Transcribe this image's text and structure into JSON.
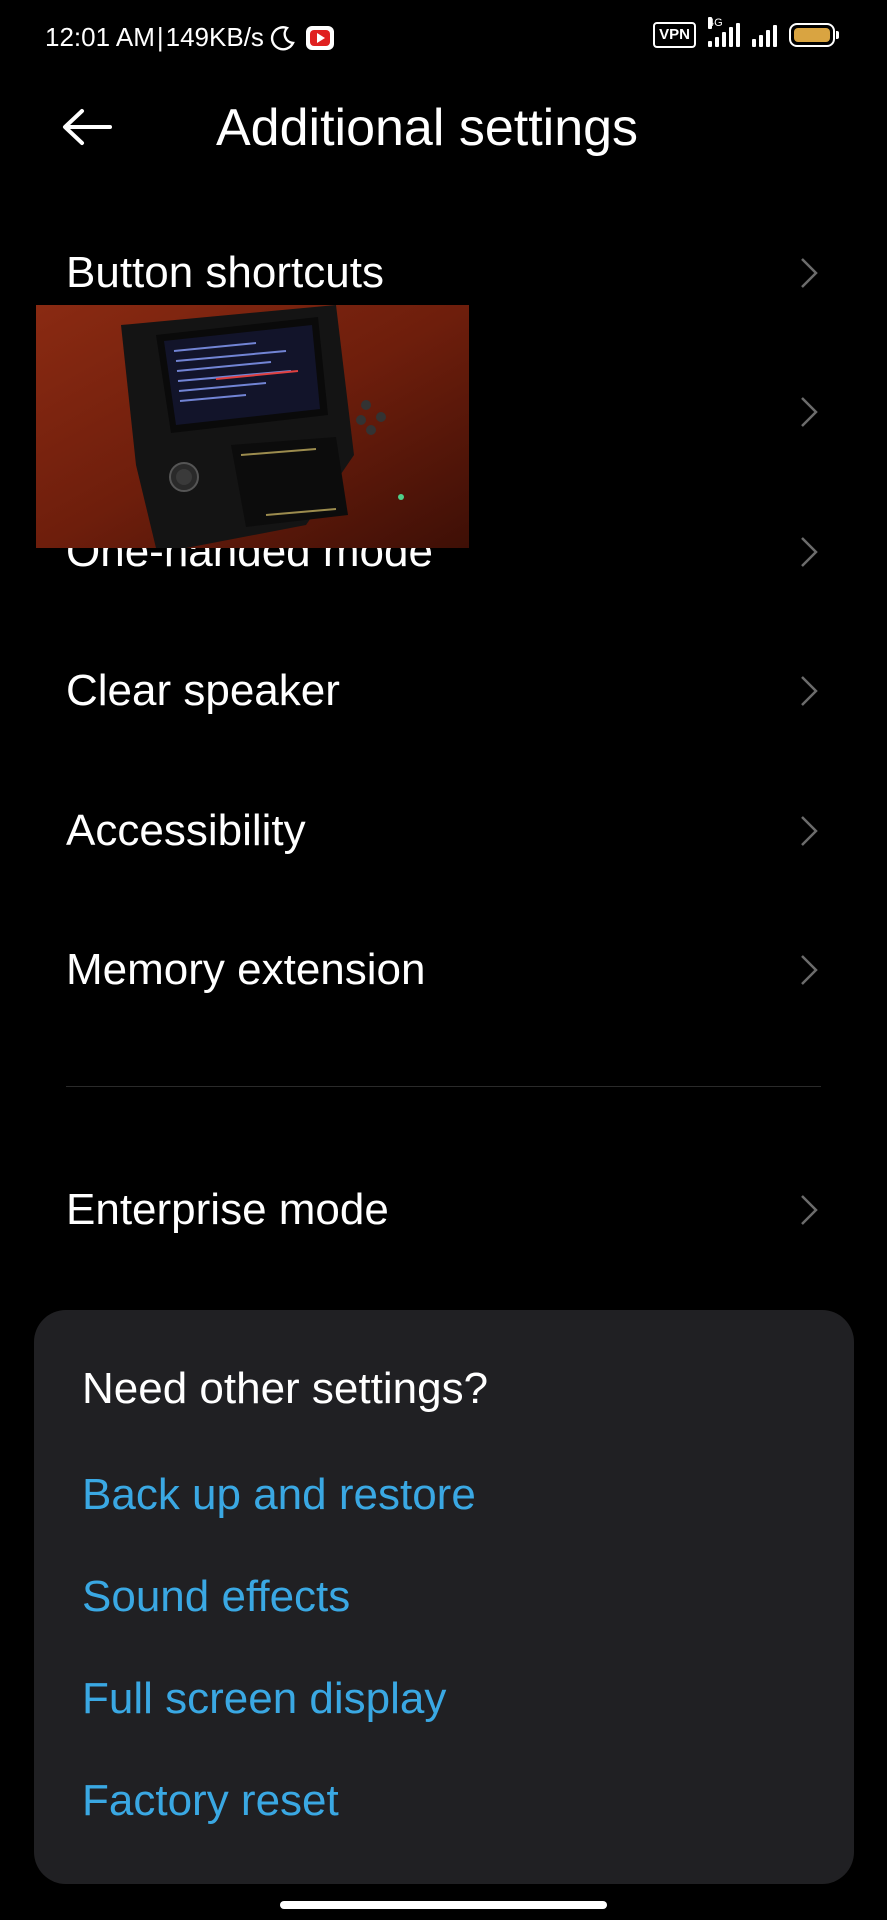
{
  "status_bar": {
    "time": "12:01 AM",
    "separator": "|",
    "speed": "149KB/s",
    "icons": [
      "moon-icon",
      "youtube-icon",
      "vpn-badge",
      "signal-4g-icon",
      "signal-icon",
      "battery-icon"
    ],
    "vpn_label": "VPN",
    "network_label": "4G",
    "battery_color": "#d9a441"
  },
  "header": {
    "back_icon": "arrow-left-icon",
    "title": "Additional settings"
  },
  "settings": {
    "items": [
      {
        "label": "Button shortcuts"
      },
      {
        "label": ""
      },
      {
        "label": "One-handed mode"
      },
      {
        "label": "Clear speaker"
      },
      {
        "label": "Accessibility"
      },
      {
        "label": "Memory extension"
      },
      {
        "label": "Enterprise mode"
      }
    ]
  },
  "card": {
    "title": "Need other settings?",
    "links": [
      "Back up and restore",
      "Sound effects",
      "Full screen display",
      "Factory reset"
    ],
    "link_color": "#3aa8e3"
  },
  "colors": {
    "background": "#000000",
    "card_background": "#202023",
    "text": "#ffffff"
  }
}
